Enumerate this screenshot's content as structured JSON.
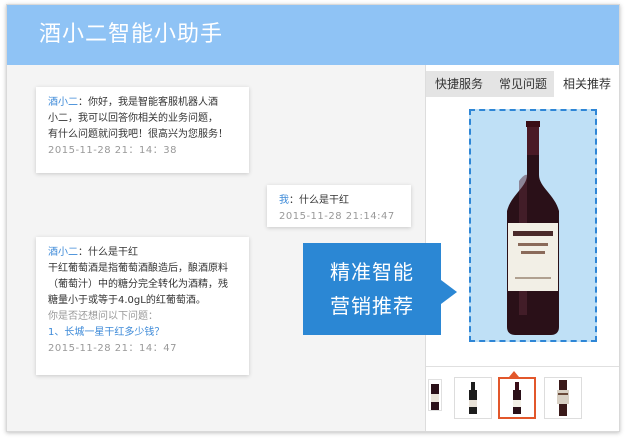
{
  "header": {
    "title": "酒小二智能小助手"
  },
  "chat": {
    "messages": [
      {
        "sender": "酒小二",
        "lines": [
          "：你好，我是智能客服机器人酒",
          "小二，我可以回答你相关的业务问题，",
          "有什么问题就问我吧！很高兴为您服务！"
        ],
        "time": "2015-11-28  21：14：38"
      },
      {
        "sender": "我",
        "lines": [
          "：什么是干红"
        ],
        "time": "2015-11-28  21:14:47"
      },
      {
        "sender": "酒小二",
        "lines": [
          "：什么是干红",
          "干红葡萄酒是指葡萄酒酿造后，酿酒原料",
          "（葡萄汁）中的糖分完全转化为酒精，残",
          "糖量小于或等于4.0gL的红葡萄酒。"
        ],
        "hint": "你是否还想问以下问题：",
        "link": "1、长城一星干红多少钱？",
        "time": "2015-11-28  21：14：47"
      }
    ]
  },
  "sidebar": {
    "tabs": [
      {
        "label": "快捷服务",
        "active": false
      },
      {
        "label": "常见问题",
        "active": false
      },
      {
        "label": "相关推荐",
        "active": true
      }
    ],
    "product_image": "red-wine-bottle",
    "thumbnails": [
      "wine-bottle-dark",
      "wine-bottle-red",
      "wine-bottle-label"
    ],
    "selected_thumbnail": 1
  },
  "callout": {
    "line1": "精准智能",
    "line2": "营销推荐"
  },
  "colors": {
    "header_bg": "#8fc3f5",
    "accent": "#2b87d4",
    "sender": "#3d8ad8",
    "selected_thumb": "#e2572b",
    "product_bg": "#bfe0f6"
  }
}
